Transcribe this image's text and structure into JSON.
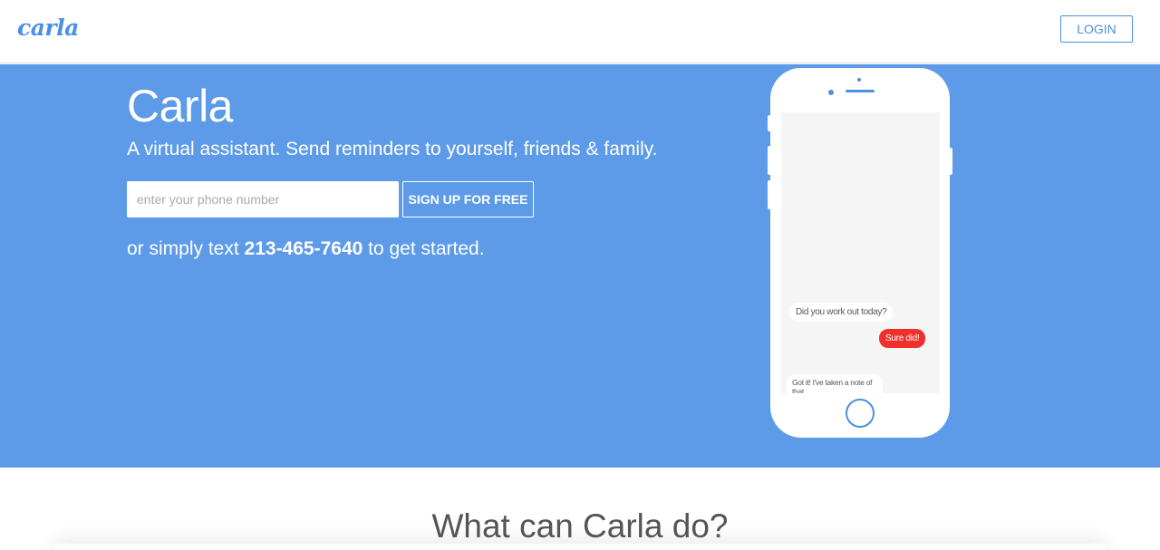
{
  "nav": {
    "brand": "carla",
    "login_label": "LOGIN"
  },
  "hero": {
    "title": "Carla",
    "tagline": "A virtual assistant. Send reminders to yourself, friends & family.",
    "phone_placeholder": "enter your phone number",
    "signup_label": "SIGN UP FOR FREE",
    "alt_prefix": "or simply text ",
    "alt_number": "213-465-7640",
    "alt_suffix": " to get started."
  },
  "phone_chat": {
    "messages": [
      {
        "from": "carla",
        "text": "Did you work out today?"
      },
      {
        "from": "user",
        "text": "Sure did!"
      },
      {
        "from": "carla",
        "text": "Got it! I've taken a note of that."
      }
    ]
  },
  "features": {
    "title": "What can Carla do?"
  },
  "colors": {
    "accent": "#4a90e2",
    "hero_bg": "#5d9be8",
    "user_bubble": "#f0302a"
  }
}
